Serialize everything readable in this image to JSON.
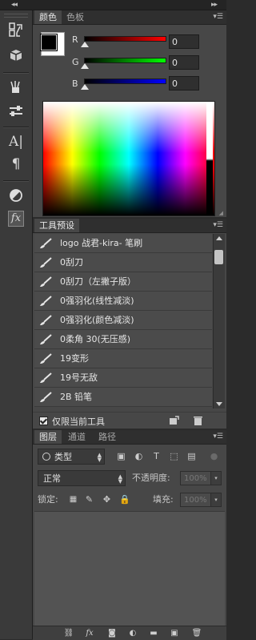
{
  "colors": {
    "red": "#e02020",
    "green": "#20c020",
    "blue": "#2030e0",
    "fg": "#000000",
    "bg": "#ffffff"
  },
  "color_panel": {
    "tabs": [
      "颜色",
      "色板"
    ],
    "channels": [
      {
        "label": "R",
        "value": "0"
      },
      {
        "label": "G",
        "value": "0"
      },
      {
        "label": "B",
        "value": "0"
      }
    ]
  },
  "presets": {
    "title": "工具预设",
    "items": [
      "logo 战君-kira- 笔刷",
      "0刮刀",
      "0刮刀（左撇子版）",
      "0强羽化(线性减淡)",
      "0强羽化(颜色减淡)",
      "0柔角 30(无压感)",
      "19变形",
      "19号无敌",
      "2B 铅笔"
    ],
    "footer_checkbox": "仅限当前工具"
  },
  "layers": {
    "tabs": [
      "图层",
      "通道",
      "路径"
    ],
    "filter_label": "类型",
    "blend_mode": "正常",
    "opacity_label": "不透明度:",
    "opacity_value": "100%",
    "lock_label": "锁定:",
    "fill_label": "填充:",
    "fill_value": "100%"
  },
  "icons": {
    "toolbar": [
      "history-icon",
      "3d-icon",
      "brush-presets-icon",
      "adjust-icon",
      "character-icon",
      "paragraph-icon",
      "adjustments-circle-icon",
      "styles-fx-icon"
    ],
    "layer_footer": [
      "link-icon",
      "fx",
      "mask-icon",
      "adjustment-layer-icon",
      "group-icon",
      "new-layer-icon",
      "trash-icon"
    ]
  }
}
